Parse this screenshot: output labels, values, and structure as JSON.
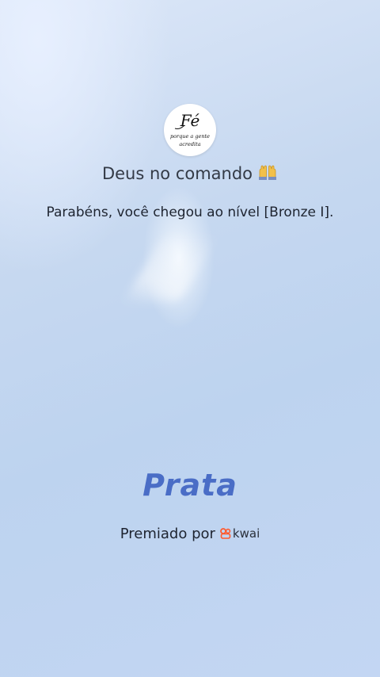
{
  "profile": {
    "avatar_icon": "fe-logo-icon",
    "avatar_text_main": "Fé",
    "avatar_text_sub": "porque a gente acredita"
  },
  "header": {
    "title": "Deus no comando",
    "title_emoji_icon": "raised-hands-icon"
  },
  "message": {
    "text": "Parabéns, você chegou ao nível [Bronze I]."
  },
  "reward": {
    "level_name": "Prata",
    "awarded_by_label": "Premiado por",
    "brand_name": "kwai",
    "brand_icon": "kwai-logo-icon"
  },
  "colors": {
    "level_text": "#4a6dc6",
    "brand_accent": "#ff5a2e"
  }
}
